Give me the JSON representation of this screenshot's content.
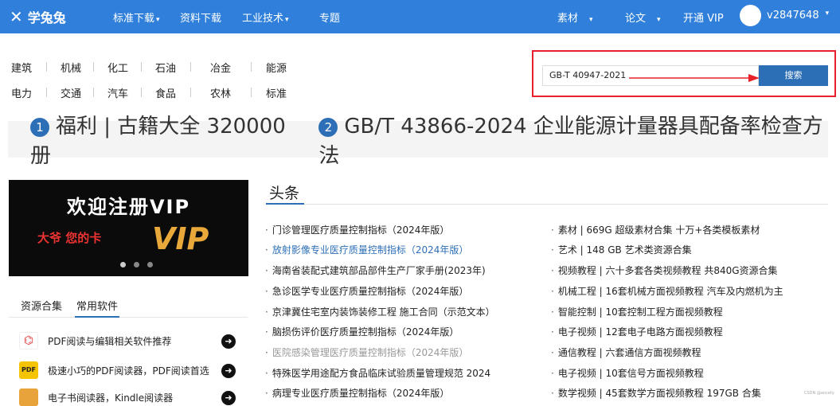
{
  "nav": {
    "logo": "学兔兔",
    "items": [
      {
        "label": "标准下载",
        "caret": true
      },
      {
        "label": "资料下载",
        "caret": false
      },
      {
        "label": "工业技术",
        "caret": true
      },
      {
        "label": "专题",
        "caret": false
      }
    ],
    "right": [
      {
        "label": "素材",
        "caret": true
      },
      {
        "label": "论文",
        "caret": true
      },
      {
        "label": "开通 VIP",
        "caret": false
      }
    ],
    "username": "v2847648"
  },
  "categories": {
    "row1": [
      "建筑",
      "机械",
      "化工",
      "石油",
      "冶金",
      "能源"
    ],
    "row2": [
      "电力",
      "交通",
      "汽车",
      "食品",
      "农林",
      "标准"
    ]
  },
  "search": {
    "value": "GB-T 40947-2021",
    "button": "搜索"
  },
  "banner": {
    "items": [
      {
        "num": "1",
        "text": "福利 | 古籍大全 320000册"
      },
      {
        "num": "2",
        "text": "GB/T 43866-2024 企业能源计量器具配备率检查方法"
      }
    ]
  },
  "promo": {
    "title": "欢迎注册VIP",
    "subtitle": "大爷 您的卡",
    "vip": "VIP"
  },
  "side_tabs": {
    "tabs": [
      "资源合集",
      "常用软件"
    ],
    "active": "常用软件",
    "items": [
      {
        "label": "PDF阅读与编辑相关软件推荐",
        "icon": "pdf-icon"
      },
      {
        "label": "极速小巧的PDF阅读器，PDF阅读首选",
        "icon": "pdf-reader-icon"
      },
      {
        "label": "电子书阅读器，Kindle阅读器",
        "icon": "book-icon"
      }
    ]
  },
  "headlines": {
    "title": "头条",
    "left": [
      {
        "text": "门诊管理医疗质量控制指标（2024年版）",
        "style": "normal"
      },
      {
        "text": "放射影像专业医疗质量控制指标（2024年版）",
        "style": "blue"
      },
      {
        "text": "海南省装配式建筑部品部件生产厂家手册(2023年)",
        "style": "normal"
      },
      {
        "text": "急诊医学专业医疗质量控制指标（2024年版）",
        "style": "normal"
      },
      {
        "text": "京津冀住宅室内装饰装修工程 施工合同（示范文本）",
        "style": "normal"
      },
      {
        "text": "脑损伤评价医疗质量控制指标（2024年版）",
        "style": "normal"
      },
      {
        "text": "医院感染管理医疗质量控制指标（2024年版）",
        "style": "gray"
      },
      {
        "text": "特殊医学用途配方食品临床试验质量管理规范 2024",
        "style": "normal"
      },
      {
        "text": "病理专业医疗质量控制指标（2024年版）",
        "style": "normal"
      }
    ],
    "right": [
      {
        "text": "素材 | 669G 超级素材合集 十万+各类模板素材"
      },
      {
        "text": "艺术 | 148 GB 艺术类资源合集"
      },
      {
        "text": "视频教程 | 六十多套各类视频教程 共840G资源合集"
      },
      {
        "text": "机械工程 | 16套机械方面视频教程 汽车及内燃机为主"
      },
      {
        "text": "智能控制 | 10套控制工程方面视频教程"
      },
      {
        "text": "电子视频 | 12套电子电路方面视频教程"
      },
      {
        "text": "通信教程 | 六套通信方面视频教程"
      },
      {
        "text": "电子视频 | 10套信号方面视频教程"
      },
      {
        "text": "数学视频 | 45套数学方面视频教程 197GB 合集"
      }
    ]
  },
  "watermark": "CSDN @ancety",
  "colors": {
    "nav": "#2f7fdb",
    "accent": "#2d6fb6",
    "highlight": "#e8202a"
  }
}
